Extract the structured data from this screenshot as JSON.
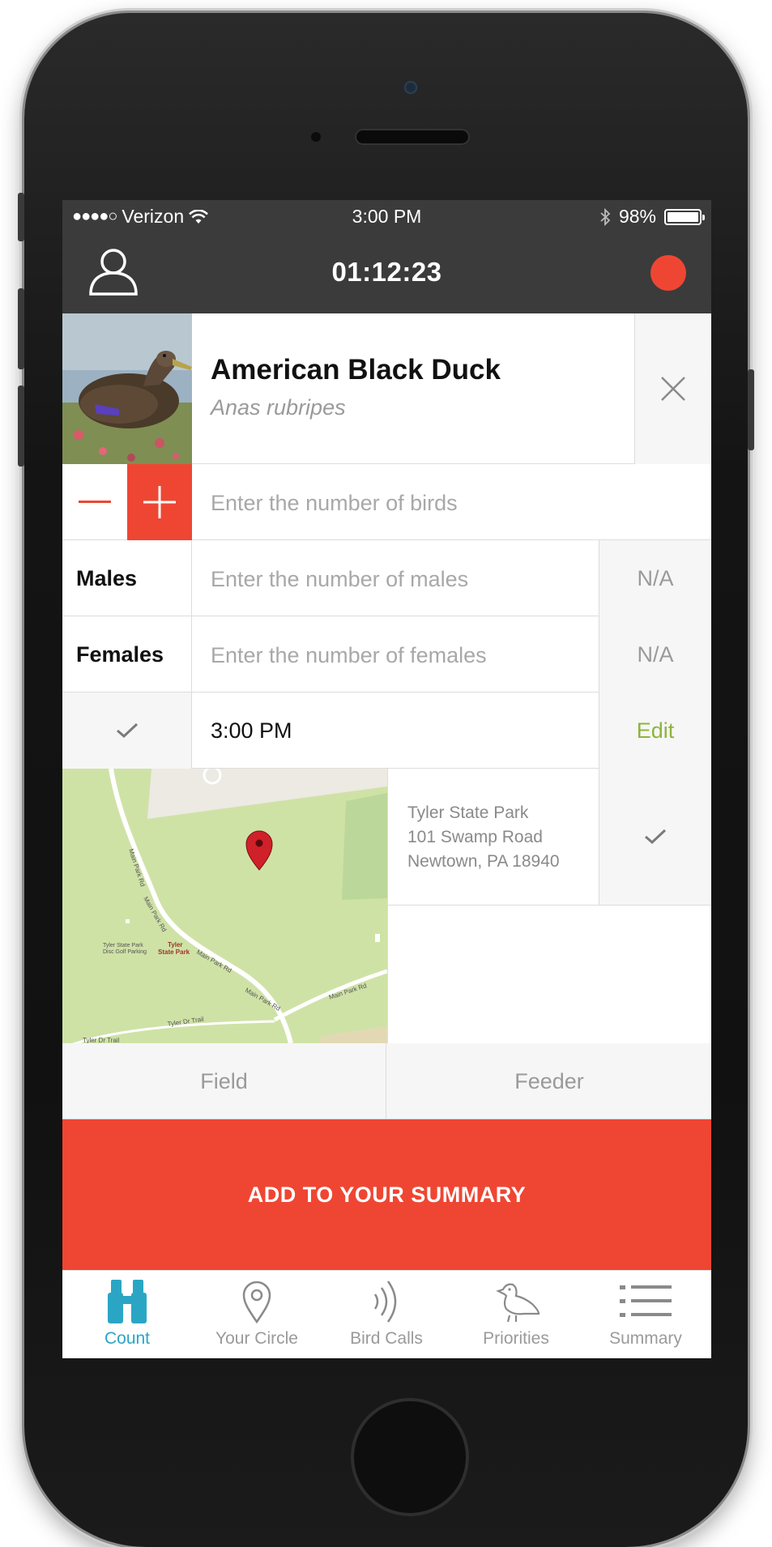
{
  "status_bar": {
    "signal": "●●●●○",
    "carrier": "Verizon",
    "time": "3:00 PM",
    "battery": "98%"
  },
  "header": {
    "timer": "01:12:23",
    "profile_icon": "user-icon",
    "record_color": "#ef4633"
  },
  "species": {
    "common_name": "American Black Duck",
    "latin_name": "Anas rubripes"
  },
  "count": {
    "placeholder": "Enter the number of birds"
  },
  "males": {
    "label": "Males",
    "placeholder": "Enter the number of males",
    "na": "N/A"
  },
  "females": {
    "label": "Females",
    "placeholder": "Enter the number of females",
    "na": "N/A"
  },
  "time_row": {
    "time": "3:00 PM",
    "edit": "Edit"
  },
  "location": {
    "line1": "Tyler State Park",
    "line2": "101 Swamp Road",
    "line3": "Newtown, PA 18940",
    "map_labels": {
      "tyler": "Tyler",
      "state_park": "State Park",
      "golf1": "Tyler State Park",
      "golf2": "Disc Golf Parking",
      "road_main1": "Main Park Rd",
      "road_main2": "Main Park Rd",
      "road_main3": "Main Park Rd",
      "road_main4": "Main Park Rd",
      "road_main5": "Main Park Rd",
      "trail1": "Tyler Dr Trail",
      "trail2": "Tyler Dr Trail"
    }
  },
  "habitat": {
    "option1": "Field",
    "option2": "Feeder"
  },
  "cta": {
    "label": "ADD TO YOUR SUMMARY"
  },
  "tabs": [
    {
      "label": "Count",
      "icon": "binoculars-icon",
      "active": true
    },
    {
      "label": "Your Circle",
      "icon": "location-pin-icon",
      "active": false
    },
    {
      "label": "Bird Calls",
      "icon": "sound-waves-icon",
      "active": false
    },
    {
      "label": "Priorities",
      "icon": "bird-icon",
      "active": false
    },
    {
      "label": "Summary",
      "icon": "list-icon",
      "active": false
    }
  ],
  "colors": {
    "accent_red": "#ef4633",
    "active_tab": "#2aa6c4",
    "edit_green": "#8db43b",
    "header_bg": "#3b3b3b"
  }
}
